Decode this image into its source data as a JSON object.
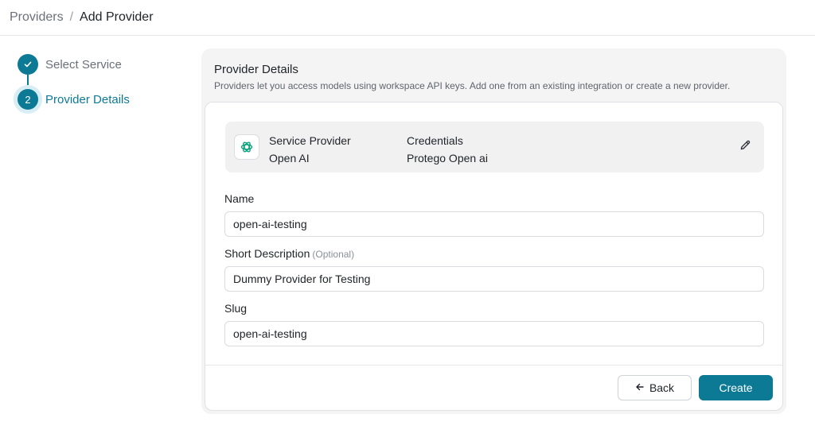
{
  "breadcrumb": {
    "parent": "Providers",
    "separator": "/",
    "current": "Add Provider"
  },
  "stepper": {
    "steps": [
      {
        "label": "Select Service",
        "status": "completed",
        "icon": "check-icon"
      },
      {
        "label": "Provider Details",
        "status": "active",
        "number": "2"
      }
    ]
  },
  "panel": {
    "title": "Provider Details",
    "description": "Providers let you access models using workspace API keys. Add one from an existing integration or create a new provider."
  },
  "provider_summary": {
    "service_label": "Service Provider",
    "service_value": "Open AI",
    "credentials_label": "Credentials",
    "credentials_value": "Protego Open ai",
    "logo_icon": "openai-logo-icon",
    "edit_icon": "pencil-icon"
  },
  "form": {
    "name": {
      "label": "Name",
      "value": "open-ai-testing"
    },
    "short_description": {
      "label": "Short Description",
      "optional": "(Optional)",
      "value": "Dummy Provider for Testing"
    },
    "slug": {
      "label": "Slug",
      "value": "open-ai-testing"
    }
  },
  "actions": {
    "back_label": "Back",
    "back_icon": "arrow-left-icon",
    "create_label": "Create"
  },
  "colors": {
    "accent": "#0d7a95",
    "panel_bg": "#f4f4f5"
  }
}
